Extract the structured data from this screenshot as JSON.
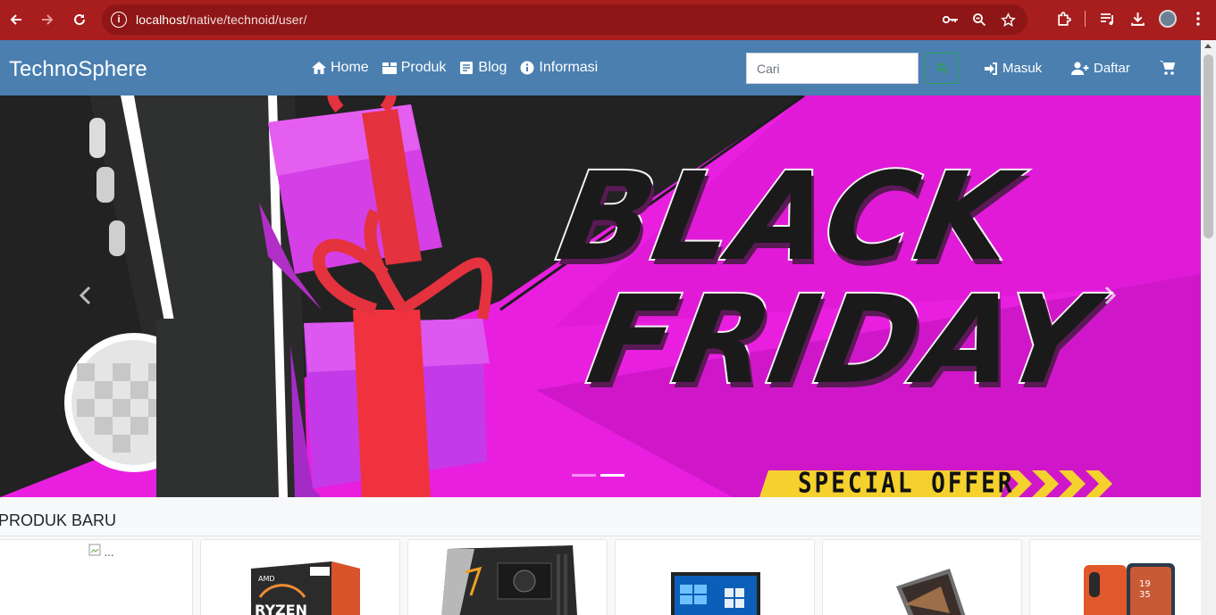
{
  "browser": {
    "url_host": "localhost",
    "url_path": "/native/technoid/user/"
  },
  "navbar": {
    "brand": "TechnoSphere",
    "menu": [
      {
        "label": "Home",
        "icon": "home-icon"
      },
      {
        "label": "Produk",
        "icon": "box-icon"
      },
      {
        "label": "Blog",
        "icon": "blog-icon"
      },
      {
        "label": "Informasi",
        "icon": "info-circle-icon"
      }
    ],
    "search_placeholder": "Cari",
    "login_label": "Masuk",
    "register_label": "Daftar"
  },
  "carousel": {
    "banner_line1": "BLACK",
    "banner_line2": "FRIDAY",
    "banner_offer": "SPECIAL OFFER",
    "slide_count": 2,
    "active_slide": 2
  },
  "products": {
    "section_title": "PRODUK BARU",
    "first_card_alt": "...",
    "items": [
      {
        "name": "broken-image"
      },
      {
        "name": "amd-ryzen-cpu"
      },
      {
        "name": "motherboard"
      },
      {
        "name": "windows-laptop"
      },
      {
        "name": "convertible-laptop"
      },
      {
        "name": "oppo-phone"
      }
    ]
  },
  "colors": {
    "browser_bar": "#a81d1d",
    "navbar": "#4a7fb0",
    "banner_magenta": "#e91fe0",
    "search_green": "#2d9f54"
  }
}
